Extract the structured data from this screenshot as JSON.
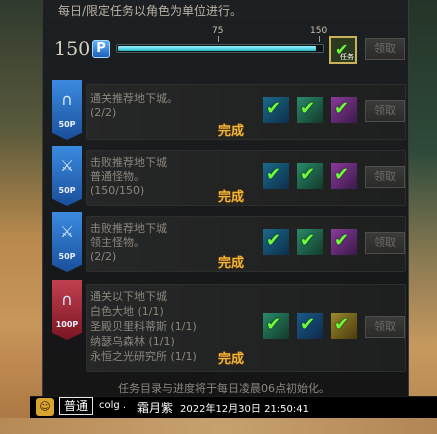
{
  "intro_text": "每日/限定任务以角色为单位进行。",
  "progress": {
    "level": "150",
    "level_icon": "P",
    "tick_75": "75",
    "tick_150": "150",
    "fraction": 0.97,
    "final_reward_label": "任务",
    "claim_label": "领取"
  },
  "tasks": [
    {
      "badge_points": "50P",
      "badge_color": "#1f5fb0",
      "badge_icon": "gate-icon",
      "lines": [
        "通关推荐地下城。",
        "(2/2)"
      ],
      "status": "完成",
      "claim_label": "领取"
    },
    {
      "badge_points": "50P",
      "badge_color": "#1f5fb0",
      "badge_icon": "sword-icon",
      "lines": [
        "击败推荐地下城",
        "普通怪物。",
        "(150/150)"
      ],
      "status": "完成",
      "claim_label": "领取"
    },
    {
      "badge_points": "50P",
      "badge_color": "#1f5fb0",
      "badge_icon": "sword-icon",
      "lines": [
        "击败推荐地下城",
        "领主怪物。",
        "(2/2)"
      ],
      "status": "完成",
      "claim_label": "领取"
    },
    {
      "badge_points": "100P",
      "badge_color": "#8e1f2a",
      "badge_icon": "gate-icon",
      "lines": [
        "通关以下地下城",
        "白色大地 (1/1)",
        "圣殿贝里科蒂斯 (1/1)",
        "纳瑟乌森林 (1/1)",
        "永恒之光研究所 (1/1)"
      ],
      "status": "完成",
      "claim_label": "领取"
    }
  ],
  "footer_note": "任务目录与进度将于每日凌晨06点初始化。",
  "chat": {
    "channel": "普通",
    "username": "colg .",
    "name": "霜月紫",
    "timestamp": "2022年12月30日 21:50:41"
  }
}
